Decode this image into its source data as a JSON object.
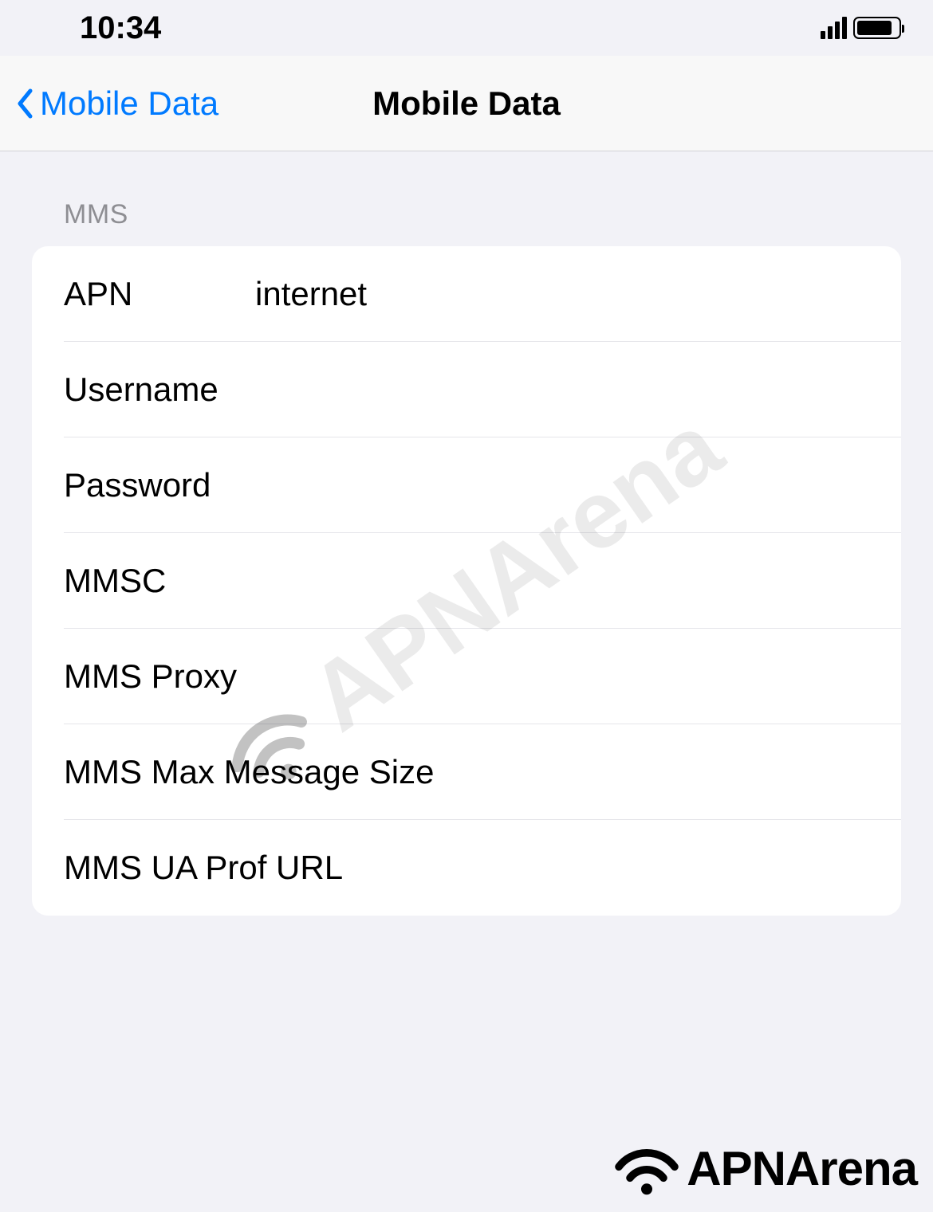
{
  "statusBar": {
    "time": "10:34"
  },
  "navBar": {
    "backLabel": "Mobile Data",
    "title": "Mobile Data"
  },
  "section": {
    "header": "MMS",
    "rows": {
      "apn": {
        "label": "APN",
        "value": "internet"
      },
      "username": {
        "label": "Username",
        "value": ""
      },
      "password": {
        "label": "Password",
        "value": ""
      },
      "mmsc": {
        "label": "MMSC",
        "value": ""
      },
      "mmsProxy": {
        "label": "MMS Proxy",
        "value": ""
      },
      "mmsMaxSize": {
        "label": "MMS Max Message Size",
        "value": ""
      },
      "mmsUaProf": {
        "label": "MMS UA Prof URL",
        "value": ""
      }
    }
  },
  "watermark": {
    "text": "APNArena"
  },
  "footer": {
    "text": "APNArena"
  }
}
